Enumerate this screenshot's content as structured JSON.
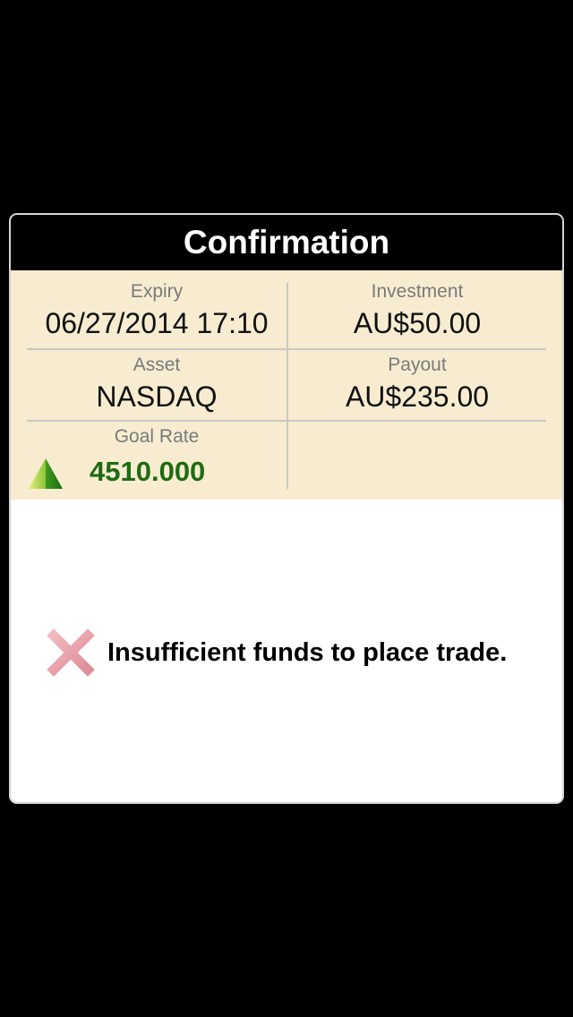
{
  "dialog": {
    "title": "Confirmation"
  },
  "details": {
    "expiry": {
      "label": "Expiry",
      "value": "06/27/2014 17:10"
    },
    "investment": {
      "label": "Investment",
      "value": "AU$50.00"
    },
    "asset": {
      "label": "Asset",
      "value": "NASDAQ"
    },
    "payout": {
      "label": "Payout",
      "value": "AU$235.00"
    },
    "goal_rate": {
      "label": "Goal Rate",
      "value": "4510.000",
      "direction_icon": "up-arrow-icon"
    }
  },
  "message": {
    "icon": "error-x-icon",
    "text": "Insufficient funds to place trade."
  },
  "colors": {
    "header_bg": "#000000",
    "details_bg": "#f7ecd0",
    "goal_rate_color": "#1e6b12",
    "error_icon_color": "#e8a0a8"
  }
}
